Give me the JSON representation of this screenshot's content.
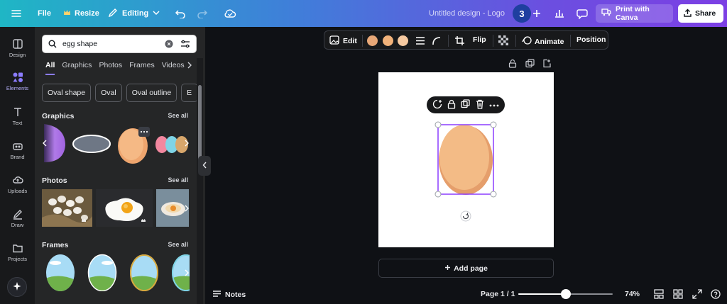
{
  "header": {
    "file_label": "File",
    "resize_label": "Resize",
    "editing_label": "Editing",
    "design_title": "Untitled design - Logo",
    "collaborator_count": "3",
    "print_label": "Print with Canva",
    "share_label": "Share"
  },
  "rail": {
    "items": [
      {
        "label": "Design",
        "icon": "design-icon"
      },
      {
        "label": "Elements",
        "icon": "elements-icon"
      },
      {
        "label": "Text",
        "icon": "text-icon"
      },
      {
        "label": "Brand",
        "icon": "brand-icon"
      },
      {
        "label": "Uploads",
        "icon": "uploads-icon"
      },
      {
        "label": "Draw",
        "icon": "draw-icon"
      },
      {
        "label": "Projects",
        "icon": "projects-icon"
      }
    ],
    "active": "Elements"
  },
  "panel": {
    "search_value": "egg shape",
    "tabs": [
      "All",
      "Graphics",
      "Photos",
      "Frames",
      "Videos"
    ],
    "active_tab": "All",
    "chips": [
      "Oval shape",
      "Oval",
      "Oval outline",
      "E"
    ],
    "sections": {
      "graphics": {
        "title": "Graphics",
        "see_all": "See all"
      },
      "photos": {
        "title": "Photos",
        "see_all": "See all"
      },
      "frames": {
        "title": "Frames",
        "see_all": "See all"
      }
    }
  },
  "context_toolbar": {
    "edit_label": "Edit",
    "colors": [
      "#e9a878",
      "#f2b27a",
      "#f6c9a0"
    ],
    "flip_label": "Flip",
    "animate_label": "Animate",
    "position_label": "Position"
  },
  "canvas": {
    "background": "#ffffff",
    "egg_color": "#f3bb86",
    "egg_shade": "#e59e6b",
    "selection_color": "#8b3dff",
    "add_page_label": "Add page"
  },
  "footer": {
    "notes_label": "Notes",
    "page_indicator": "Page 1 / 1",
    "zoom_label": "74%",
    "zoom_fraction": 0.5
  }
}
